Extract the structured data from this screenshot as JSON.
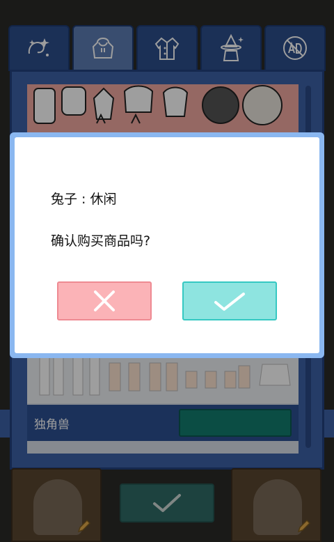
{
  "tabs": [
    {
      "name": "tab-effects",
      "icon": "sparkle-swirl-icon",
      "active": false
    },
    {
      "name": "tab-hoodie",
      "icon": "hoodie-icon",
      "active": true
    },
    {
      "name": "tab-jacket",
      "icon": "jacket-icon",
      "active": false
    },
    {
      "name": "tab-witch",
      "icon": "witch-hat-icon",
      "active": false
    },
    {
      "name": "tab-no-ads",
      "icon": "no-ads-icon",
      "active": false
    }
  ],
  "category": {
    "label": "独角兽",
    "swatch_color": "#137c6f"
  },
  "dialog": {
    "item_name": "兔子 : 休闲",
    "question": "确认购买商品吗?",
    "cancel_icon": "close-icon",
    "confirm_icon": "check-icon"
  },
  "colors": {
    "accent_blue": "#3d62a6",
    "cancel_pink": "#fbb3b7",
    "confirm_teal": "#8ee4e0",
    "modal_border": "#8ab7f0"
  }
}
